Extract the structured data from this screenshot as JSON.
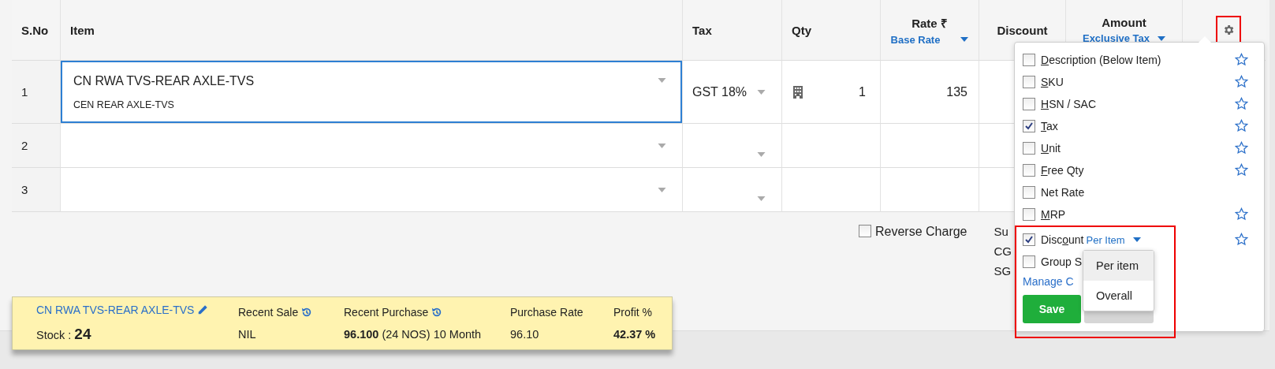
{
  "table": {
    "columns": [
      {
        "label": "S.No"
      },
      {
        "label": "Item"
      },
      {
        "label": "Tax"
      },
      {
        "label": "Qty"
      },
      {
        "label": "Rate ₹",
        "option": "Base Rate"
      },
      {
        "label": "Discount"
      },
      {
        "label": "Amount",
        "option": "Exclusive Tax"
      }
    ],
    "rows": [
      {
        "sno": "1",
        "item": "CN RWA TVS-REAR AXLE-TVS",
        "description": "CEN REAR AXLE-TVS",
        "tax": "GST 18%",
        "qty": "1",
        "rate": "135",
        "focused": true
      },
      {
        "sno": "2",
        "focused": false
      },
      {
        "sno": "3",
        "focused": false
      }
    ]
  },
  "reverse_charge": {
    "label": "Reverse Charge",
    "checked": false
  },
  "summary_labels": [
    "Su",
    "CG",
    "SG"
  ],
  "column_settings": {
    "options": [
      {
        "key": "D",
        "post": "escription (Below Item)",
        "checked": false,
        "star": true
      },
      {
        "key": "S",
        "post": "KU",
        "checked": false,
        "star": true
      },
      {
        "key": "H",
        "post": "SN / SAC",
        "checked": false,
        "star": true
      },
      {
        "key": "T",
        "post": "ax",
        "checked": true,
        "star": true
      },
      {
        "key": "U",
        "post": "nit",
        "checked": false,
        "star": true
      },
      {
        "key": "F",
        "post": "ree Qty",
        "checked": false,
        "star": true
      },
      {
        "pre": "Net Rate",
        "checked": false,
        "star": false
      },
      {
        "key": "M",
        "post": "RP",
        "checked": false,
        "star": true
      }
    ],
    "discount": {
      "pre": "Disc",
      "key": "o",
      "post": "unt",
      "checked": true,
      "star": true,
      "mode": "Per Item"
    },
    "group": {
      "label": "Group S",
      "checked": false
    },
    "manage_link": "Manage C",
    "save": "Save",
    "mode_menu": [
      {
        "label": "Per item",
        "selected": true
      },
      {
        "label": "Overall",
        "selected": false
      }
    ]
  },
  "item_info": {
    "name": "CN RWA TVS-REAR AXLE-TVS",
    "stock_label": "Stock :",
    "stock": "24",
    "columns": [
      {
        "label": "Recent Sale",
        "history": true,
        "value": "NIL",
        "bold": false
      },
      {
        "label": "Recent Purchase",
        "history": true,
        "value": "**96.100** (24 NOS) 10 Month",
        "bold": false
      },
      {
        "label": "Purchase Rate",
        "history": false,
        "value": "96.10",
        "bold": false
      },
      {
        "label": "Profit %",
        "history": false,
        "value": "42.37 %",
        "bold": true
      }
    ]
  }
}
